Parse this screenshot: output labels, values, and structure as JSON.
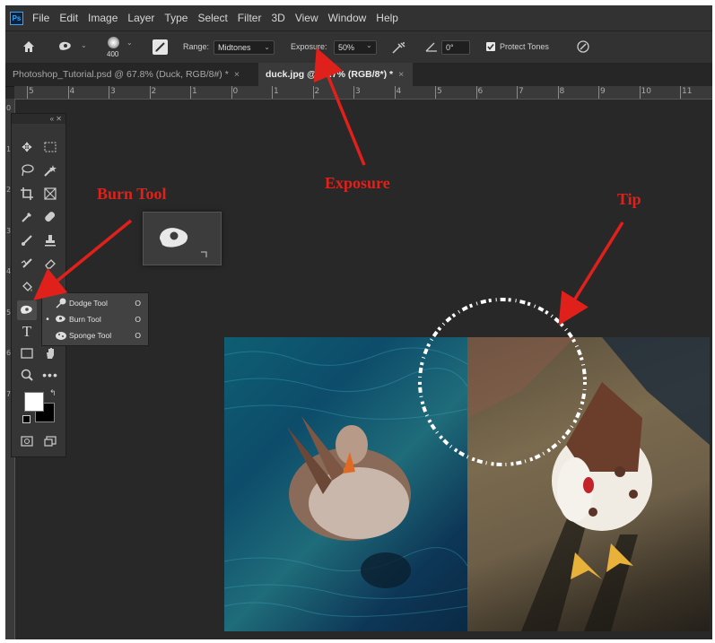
{
  "menu": [
    "File",
    "Edit",
    "Image",
    "Layer",
    "Type",
    "Select",
    "Filter",
    "3D",
    "View",
    "Window",
    "Help"
  ],
  "app_logo": "Ps",
  "options": {
    "brush_size": "400",
    "range_label": "Range:",
    "range_value": "Midtones",
    "exposure_label": "Exposure:",
    "exposure_value": "50%",
    "angle_value": "0°",
    "protect_tones_label": "Protect Tones"
  },
  "tabs": [
    {
      "label": "Photoshop_Tutorial.psd @ 67.8% (Duck, RGB/8#) *"
    },
    {
      "label": "duck.jpg @ 66.7% (RGB/8*) *"
    }
  ],
  "ruler_top": [
    "5",
    "4",
    "3",
    "2",
    "1",
    "0",
    "1",
    "2",
    "3",
    "4",
    "5",
    "6",
    "7",
    "8",
    "9",
    "10",
    "11"
  ],
  "ruler_left": [
    "0",
    "1",
    "2",
    "3",
    "4",
    "5",
    "6",
    "7"
  ],
  "flyout": [
    {
      "label": "Dodge Tool",
      "key": "O",
      "selected": false
    },
    {
      "label": "Burn Tool",
      "key": "O",
      "selected": true
    },
    {
      "label": "Sponge Tool",
      "key": "O",
      "selected": false
    }
  ],
  "annotations": {
    "burn_tool": "Burn Tool",
    "exposure": "Exposure",
    "tip": "Tip"
  },
  "colors": {
    "annotation_red": "#e0201a",
    "app_bg": "#282828",
    "panel_bg": "#323232"
  },
  "icons": [
    "home-icon",
    "burn-tool-icon",
    "brush-preset-icon",
    "toggle-brush-panel-icon",
    "airbrush-icon",
    "angle-icon",
    "pressure-icon",
    "move-icon",
    "marquee-icon",
    "lasso-icon",
    "quick-select-icon",
    "crop-icon",
    "frame-icon",
    "eyedropper-icon",
    "healing-icon",
    "brush-icon",
    "stamp-icon",
    "history-brush-icon",
    "eraser-icon",
    "paint-bucket-icon",
    "dodge-icon",
    "type-icon",
    "rectangle-icon",
    "hand-icon",
    "zoom-icon",
    "more-icon",
    "swap-colors-icon",
    "default-colors-icon",
    "quick-mask-icon",
    "screen-mode-icon"
  ]
}
